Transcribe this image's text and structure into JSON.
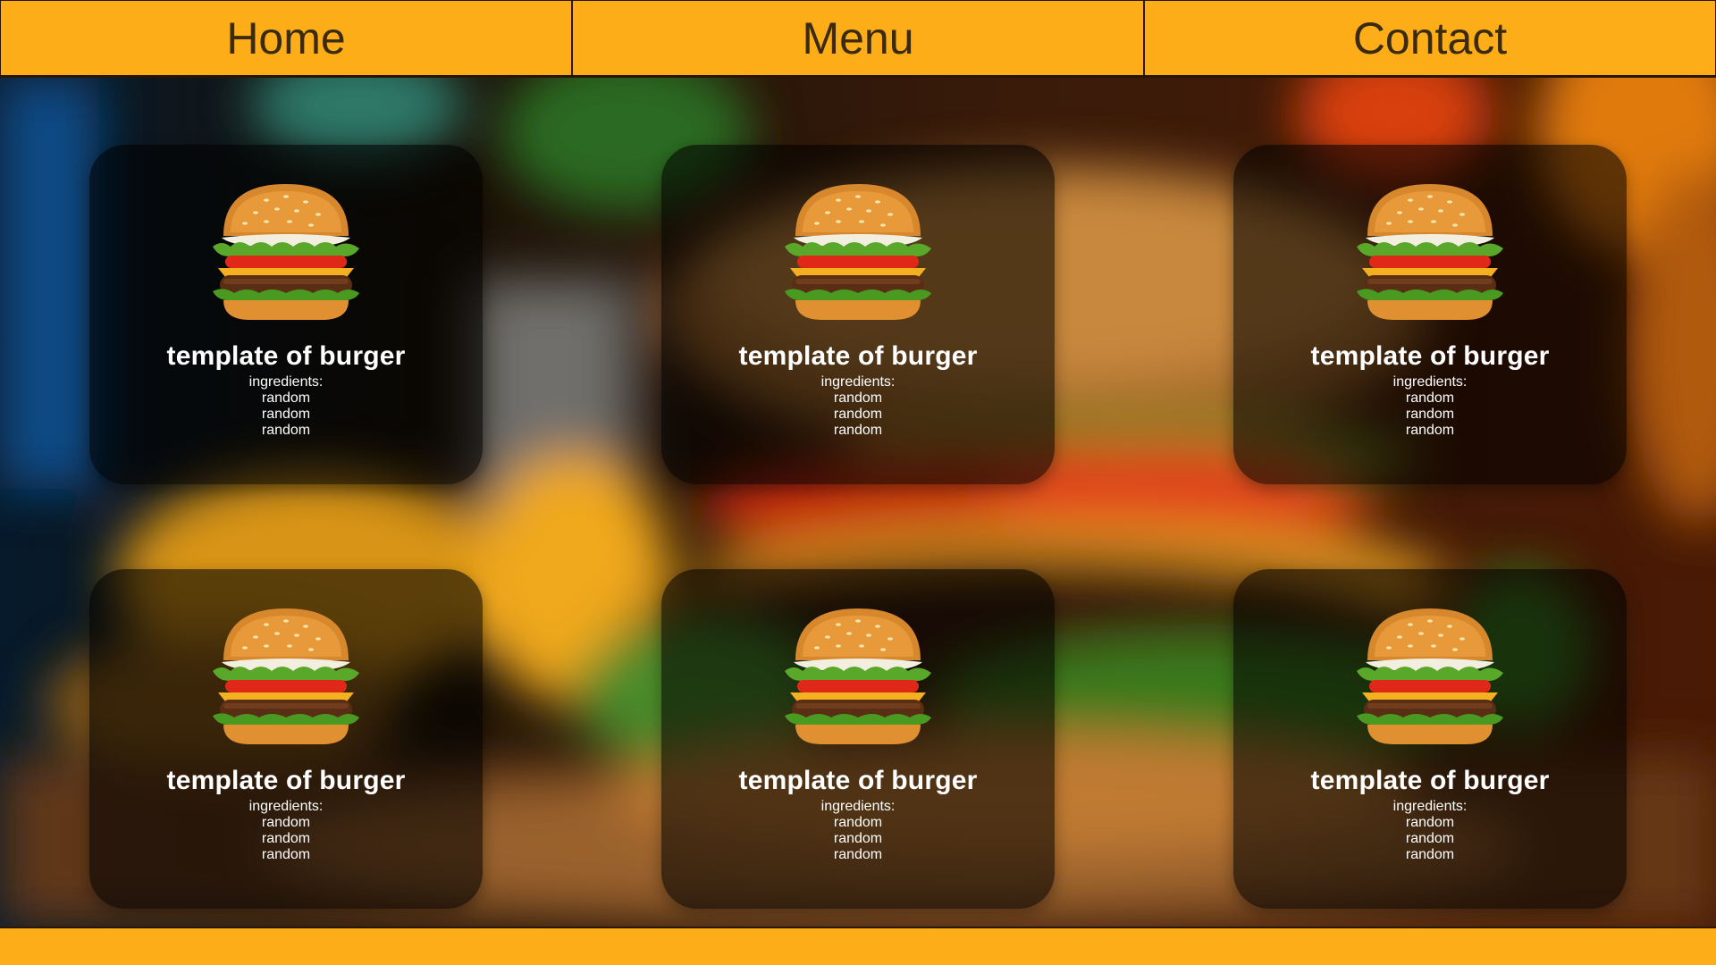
{
  "nav": {
    "items": [
      {
        "label": "Home"
      },
      {
        "label": "Menu"
      },
      {
        "label": "Contact"
      }
    ]
  },
  "cards": [
    {
      "title": "template of burger",
      "ingredients_label": "ingredients:",
      "ingredients": [
        "random",
        "random",
        "random"
      ]
    },
    {
      "title": "template of burger",
      "ingredients_label": "ingredients:",
      "ingredients": [
        "random",
        "random",
        "random"
      ]
    },
    {
      "title": "template of burger",
      "ingredients_label": "ingredients:",
      "ingredients": [
        "random",
        "random",
        "random"
      ]
    },
    {
      "title": "template of burger",
      "ingredients_label": "ingredients:",
      "ingredients": [
        "random",
        "random",
        "random"
      ]
    },
    {
      "title": "template of burger",
      "ingredients_label": "ingredients:",
      "ingredients": [
        "random",
        "random",
        "random"
      ]
    },
    {
      "title": "template of burger",
      "ingredients_label": "ingredients:",
      "ingredients": [
        "random",
        "random",
        "random"
      ]
    }
  ],
  "colors": {
    "accent": "#fcad18",
    "nav_text": "#3a2a10",
    "card_bg": "rgba(0,0,0,0.58)"
  },
  "icons": {
    "card_image": "burger-icon"
  }
}
